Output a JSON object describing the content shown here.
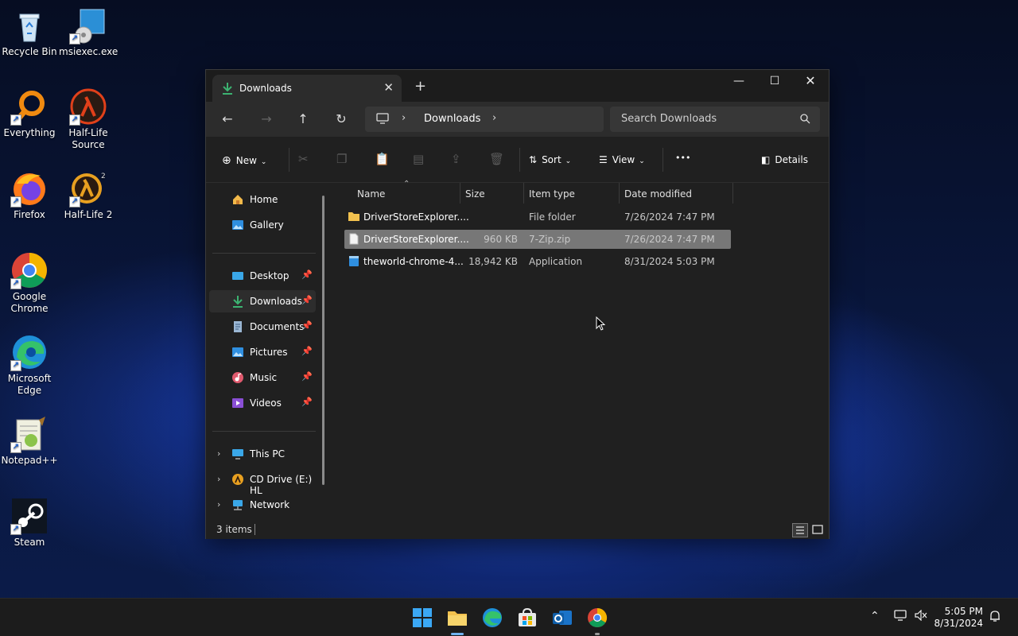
{
  "desktop": {
    "icons": [
      {
        "label": "Recycle Bin",
        "icon": "recycle-bin-icon"
      },
      {
        "label": "msiexec.exe",
        "icon": "installer-icon"
      },
      {
        "label": "Everything",
        "icon": "search-app-icon"
      },
      {
        "label": "Half-Life Source",
        "icon": "half-life-icon"
      },
      {
        "label": "Firefox",
        "icon": "firefox-icon"
      },
      {
        "label": "Half-Life 2",
        "icon": "half-life-2-icon"
      },
      {
        "label": "Google Chrome",
        "icon": "chrome-icon"
      },
      {
        "label": "Microsoft Edge",
        "icon": "edge-icon"
      },
      {
        "label": "Notepad++",
        "icon": "notepadpp-icon"
      },
      {
        "label": "Steam",
        "icon": "steam-icon"
      }
    ]
  },
  "window": {
    "tab_title": "Downloads",
    "address": {
      "segments": [
        "Downloads"
      ]
    },
    "search_placeholder": "Search Downloads",
    "toolbar": {
      "new_label": "New",
      "sort_label": "Sort",
      "view_label": "View",
      "more_label": "•••",
      "details_label": "Details"
    },
    "sidebar": {
      "items": [
        {
          "label": "Home",
          "icon": "home-icon",
          "pinned": false
        },
        {
          "label": "Gallery",
          "icon": "gallery-icon",
          "pinned": false
        },
        {
          "label": "Desktop",
          "icon": "desktop-folder-icon",
          "pinned": true
        },
        {
          "label": "Downloads",
          "icon": "downloads-folder-icon",
          "pinned": true,
          "active": true
        },
        {
          "label": "Documents",
          "icon": "documents-folder-icon",
          "pinned": true
        },
        {
          "label": "Pictures",
          "icon": "pictures-folder-icon",
          "pinned": true
        },
        {
          "label": "Music",
          "icon": "music-folder-icon",
          "pinned": true
        },
        {
          "label": "Videos",
          "icon": "videos-folder-icon",
          "pinned": true
        },
        {
          "label": "This PC",
          "icon": "this-pc-icon"
        },
        {
          "label": "CD Drive (E:) HL",
          "icon": "cd-drive-icon"
        },
        {
          "label": "Network",
          "icon": "network-icon"
        }
      ]
    },
    "columns": {
      "name": "Name",
      "size": "Size",
      "type": "Item type",
      "date": "Date modified"
    },
    "files": [
      {
        "name": "DriverStoreExplorer....",
        "size": "",
        "type": "File folder",
        "date": "7/26/2024 7:47 PM",
        "icon": "folder-icon"
      },
      {
        "name": "DriverStoreExplorer....",
        "size": "960 KB",
        "type": "7-Zip.zip",
        "date": "7/26/2024 7:47 PM",
        "icon": "zip-file-icon",
        "selected": true
      },
      {
        "name": "theworld-chrome-4...",
        "size": "18,942 KB",
        "type": "Application",
        "date": "8/31/2024 5:03 PM",
        "icon": "application-icon"
      }
    ],
    "status": "3 items"
  },
  "taskbar": {
    "apps": [
      "start-icon",
      "file-explorer-icon",
      "edge-icon",
      "store-icon",
      "outlook-icon",
      "chrome-icon"
    ],
    "time": "5:05 PM",
    "date": "8/31/2024"
  },
  "colors": {
    "window_bg": "#202020",
    "selection": "#777777",
    "accent": "#0078d4"
  }
}
